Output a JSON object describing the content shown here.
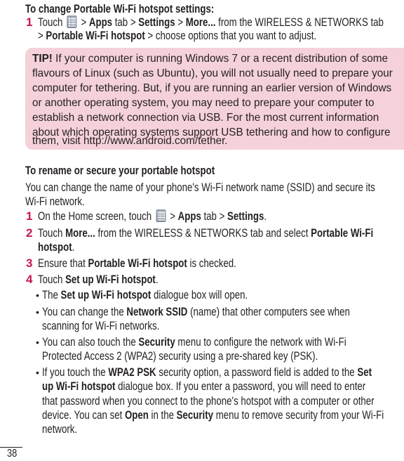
{
  "section1": {
    "heading": "To change Portable Wi-Fi hotspot settings:",
    "step1": {
      "number": "1",
      "line1": {
        "t1": "Touch ",
        "icon": "apps-grid-icon",
        "t2": " > ",
        "b1": "Apps",
        "t3": " tab > ",
        "b2": "Settings",
        "t4": " > ",
        "b3": "More...",
        "t5": " from the WIRELESS & NETWORKS tab"
      },
      "line2": {
        "t1": "> ",
        "b1": "Portable Wi-Fi hotspot",
        "t2": " > choose options that you want to adjust."
      }
    }
  },
  "tip": {
    "label": "TIP!",
    "lines": [
      " If your computer is running Windows 7 or a recent distribution of some",
      "flavours of Linux (such as Ubuntu), you will not usually need to prepare your",
      "computer for tethering. But, if you are running an earlier version of Windows",
      "or another operating system, you may need to prepare your computer to",
      "establish a network connection via USB. For the most current information",
      "about which operating systems support USB tethering and how to configure",
      "them, visit http://www.android.com/tether."
    ]
  },
  "section2": {
    "heading": "To rename or secure your portable hotspot",
    "intro": [
      "You can change the name of your phone's Wi-Fi network name (SSID) and secure its",
      "Wi-Fi network."
    ],
    "steps": {
      "s1": {
        "number": "1",
        "t1": "On the Home screen, touch ",
        "icon": "apps-grid-icon",
        "t2": " > ",
        "b1": "Apps",
        "t3": " tab > ",
        "b2": "Settings",
        "t4": "."
      },
      "s2": {
        "number": "2",
        "t1": "Touch ",
        "b1": "More...",
        "t2": " from the WIRELESS & NETWORKS tab and select ",
        "b2": "Portable Wi-Fi",
        "b3": "hotspot",
        "t3": "."
      },
      "s3": {
        "number": "3",
        "t1": "Ensure that ",
        "b1": "Portable Wi-Fi hotspot",
        "t2": " is checked."
      },
      "s4": {
        "number": "4",
        "t1": "Touch ",
        "b1": "Set up Wi-Fi hotspot",
        "t2": "."
      }
    },
    "bullets": {
      "symbol": "•",
      "b1": {
        "t1": "The ",
        "bold1": "Set up Wi-Fi hotspot",
        "t2": " dialogue box will open."
      },
      "b2": {
        "t1": "You can change the ",
        "bold1": "Network SSID",
        "t2": " (name) that other computers see when",
        "l2": "scanning for Wi-Fi networks."
      },
      "b3": {
        "t1": "You can also touch the ",
        "bold1": "Security",
        "t2": " menu to configure the network with Wi-Fi",
        "l2": "Protected Access 2 (WPA2) security using a pre-shared key (PSK)."
      },
      "b4": {
        "t1": "If you touch the ",
        "bold1": "WPA2 PSK",
        "t2": " security option, a password field is added to the ",
        "bold2": "Set",
        "l2bold": "up Wi-Fi hotspot",
        "l2": " dialogue box. If you enter a password, you will need to enter",
        "l3": "that password when you connect to the phone's hotspot with a computer or other",
        "l4a": "device. You can set ",
        "l4b1": "Open",
        "l4b": " in the ",
        "l4b2": "Security",
        "l4c": " menu to remove security from your Wi-Fi",
        "l5": "network."
      }
    }
  },
  "footer": {
    "page_number": "38"
  },
  "colors": {
    "step_number": "#c8174b",
    "tip_background": "#f5d2da",
    "icon_grey": "#8a92a3"
  }
}
